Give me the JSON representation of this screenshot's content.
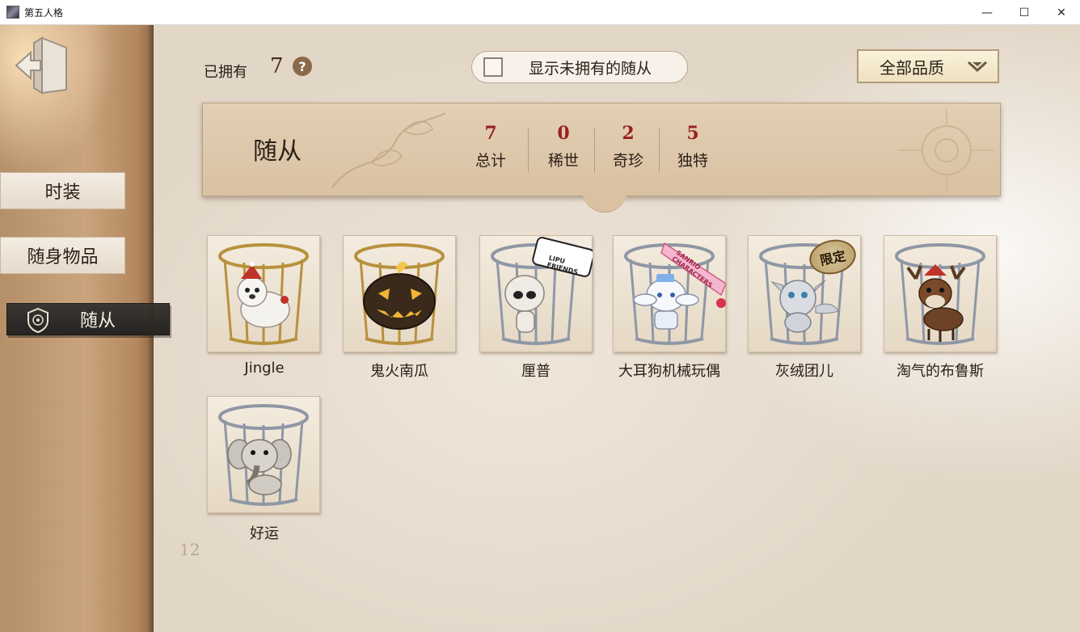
{
  "window": {
    "title": "第五人格",
    "minimize_glyph": "—",
    "maximize_glyph": "☐",
    "close_glyph": "✕"
  },
  "sidebar": {
    "items": [
      {
        "label": "时装",
        "active": false
      },
      {
        "label": "随身物品",
        "active": false
      },
      {
        "label": "随从",
        "active": true
      }
    ]
  },
  "topbar": {
    "owned_label": "已拥有",
    "owned_count": "7",
    "help_glyph": "?",
    "show_unowned_label": "显示未拥有的随从",
    "show_unowned_checked": false,
    "quality_filter": "全部品质"
  },
  "banner": {
    "title": "随从",
    "stats": [
      {
        "value": "7",
        "label": "总计"
      },
      {
        "value": "0",
        "label": "稀世"
      },
      {
        "value": "2",
        "label": "奇珍"
      },
      {
        "value": "5",
        "label": "独特"
      }
    ]
  },
  "companions": [
    {
      "name": "Jingle",
      "cage": "gold",
      "icon": "white-dog-icon"
    },
    {
      "name": "鬼火南瓜",
      "cage": "gold",
      "icon": "jack-o-lantern-icon"
    },
    {
      "name": "厘普",
      "cage": "silver",
      "icon": "alien-doll-icon",
      "sticker": "LIPU FRIENDS"
    },
    {
      "name": "大耳狗机械玩偶",
      "cage": "silver",
      "icon": "cinnamoroll-icon",
      "sticker": "SANRIO CHARACTERS"
    },
    {
      "name": "灰绒团儿",
      "cage": "silver",
      "icon": "grey-creature-icon",
      "badge": "限定"
    },
    {
      "name": "淘气的布鲁斯",
      "cage": "silver",
      "icon": "reindeer-icon"
    },
    {
      "name": "好运",
      "cage": "silver",
      "icon": "elephant-icon"
    }
  ],
  "decor": {
    "ruler_mark": "12"
  },
  "colors": {
    "stat_value": "#9a1f1f",
    "active_nav_bg": "#2f2c29",
    "banner_bg": "#dcc6a8"
  }
}
